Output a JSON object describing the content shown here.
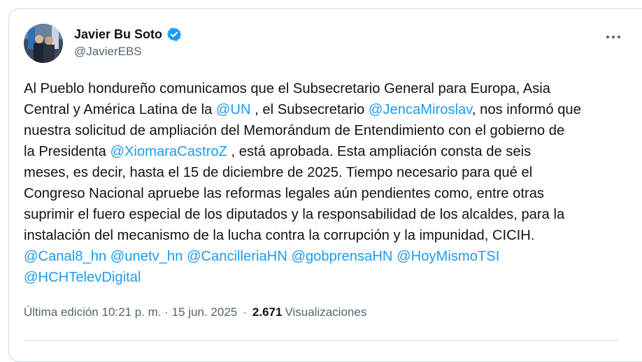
{
  "author": {
    "display_name": "Javier Bu Soto",
    "handle": "@JavierEBS",
    "verified_icon": "verified-badge-icon"
  },
  "tweet": {
    "segments": [
      {
        "text": "Al Pueblo hondureño comunicamos que el Subsecretario General para Europa, Asia\nCentral y América Latina de la ",
        "mention": false
      },
      {
        "text": "@UN",
        "mention": true
      },
      {
        "text": " , el Subsecretario ",
        "mention": false
      },
      {
        "text": "@JencaMiroslav",
        "mention": true
      },
      {
        "text": ", nos informó que\nnuestra solicitud de ampliación del Memorándum de Entendimiento con el gobierno de\nla Presidenta ",
        "mention": false
      },
      {
        "text": "@XiomaraCastroZ",
        "mention": true
      },
      {
        "text": " , está aprobada. Esta ampliación consta de seis\nmeses, es decir, hasta el 15 de diciembre de 2025. Tiempo necesario para qué el\nCongreso Nacional apruebe las reformas legales aún pendientes como, entre otras\nsuprimir el fuero especial de los diputados y la responsabilidad de los alcaldes, para la\ninstalación del mecanismo de la lucha contra la corrupción y la impunidad, CICIH.\n",
        "mention": false
      },
      {
        "text": "@Canal8_hn",
        "mention": true
      },
      {
        "text": " ",
        "mention": false
      },
      {
        "text": "@unetv_hn",
        "mention": true
      },
      {
        "text": " ",
        "mention": false
      },
      {
        "text": "@CancilleriaHN",
        "mention": true
      },
      {
        "text": " ",
        "mention": false
      },
      {
        "text": "@gobprensaHN",
        "mention": true
      },
      {
        "text": " ",
        "mention": false
      },
      {
        "text": "@HoyMismoTSI",
        "mention": true
      },
      {
        "text": "\n",
        "mention": false
      },
      {
        "text": "@HCHTelevDigital",
        "mention": true
      }
    ]
  },
  "meta": {
    "edit_label": "Última edición 10:21 p. m. · 15 jun. 2025",
    "separator": "·",
    "views_count": "2.671",
    "views_label": "Visualizaciones"
  },
  "colors": {
    "mention": "#1d9bf0",
    "verified": "#1d9bf0",
    "secondary_text": "#536471"
  }
}
